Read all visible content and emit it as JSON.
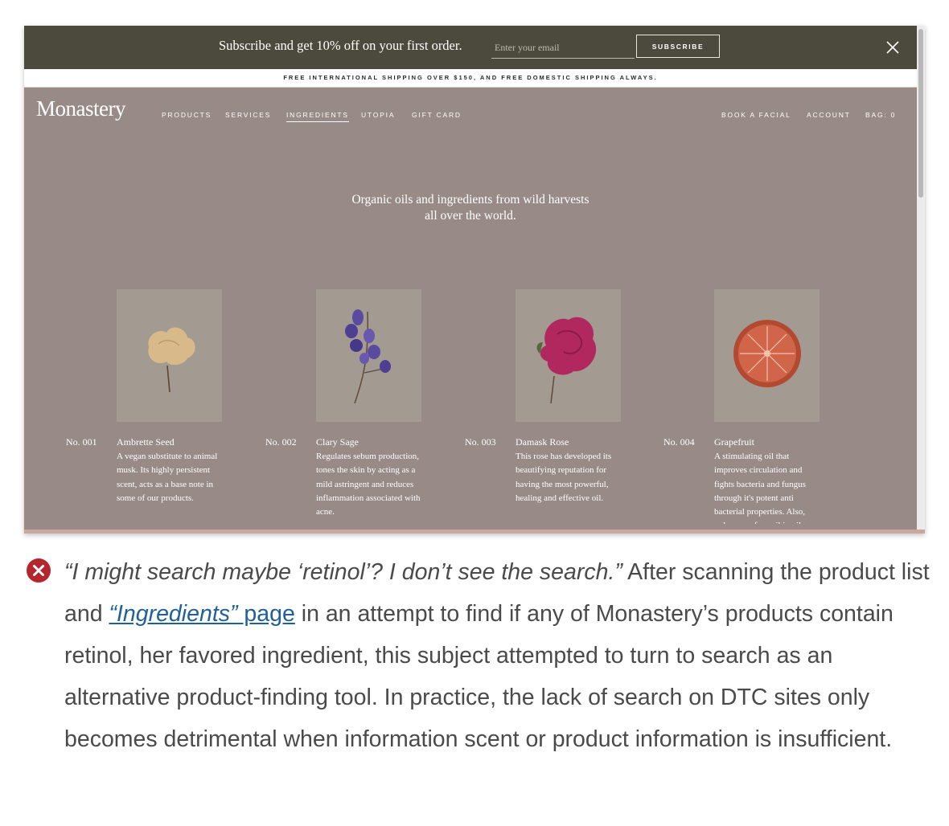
{
  "screenshot": {
    "promo": {
      "text": "Subscribe and get 10% off on your first order.",
      "email_placeholder": "Enter your email",
      "subscribe_label": "SUBSCRIBE"
    },
    "shipping_text": "FREE INTERNATIONAL SHIPPING OVER $150, AND FREE DOMESTIC SHIPPING ALWAYS.",
    "logo": "Monastery",
    "nav_left": [
      "PRODUCTS",
      "SERVICES",
      "INGREDIENTS",
      "UTOPIA",
      "GIFT CARD"
    ],
    "nav_right": [
      "BOOK A FACIAL",
      "ACCOUNT",
      "BAG: 0"
    ],
    "active_nav": "INGREDIENTS",
    "tagline_line1": "Organic oils and ingredients from wild harvests",
    "tagline_line2": "all over the world.",
    "products": [
      {
        "number": "No. 001",
        "name": "Ambrette Seed",
        "description": "A vegan substitute to animal musk. Its highly persistent scent, acts as a base note in some of our products."
      },
      {
        "number": "No. 002",
        "name": "Clary Sage",
        "description": "Regulates sebum production, tones the skin by acting as a mild astringent and reduces inflammation associated with acne."
      },
      {
        "number": "No. 003",
        "name": "Damask Rose",
        "description": "This rose has developed its beautifying reputation for having the most powerful, healing and effective oil."
      },
      {
        "number": "No. 004",
        "name": "Grapefruit",
        "description": "A stimulating oil that improves circulation and fights bacteria and fungus through it's potent anti bacterial properties. Also, reduces surface oil in oily"
      }
    ]
  },
  "article": {
    "quote": "“I might search maybe ‘retinol’? I don’t see the search.”",
    "text_before_link": " After scanning the product list and ",
    "link_italic": "“Ingredients”",
    "link_plain": " page",
    "text_after_link": " in an attempt to find if any of Monastery’s products contain retinol, her favored ingredient, this subject attempted to turn to search as an alternative product-finding tool. In practice, the lack of search on DTC sites only becomes detrimental when information scent or product information is insufficient."
  },
  "colors": {
    "promo_bg": "#4c4a3c",
    "site_bg": "#978a87",
    "error_red": "#b6252e",
    "link_blue": "#1f5f9b",
    "body_text": "#4a4a4a"
  },
  "icons": [
    "close-icon",
    "error-x-icon"
  ]
}
